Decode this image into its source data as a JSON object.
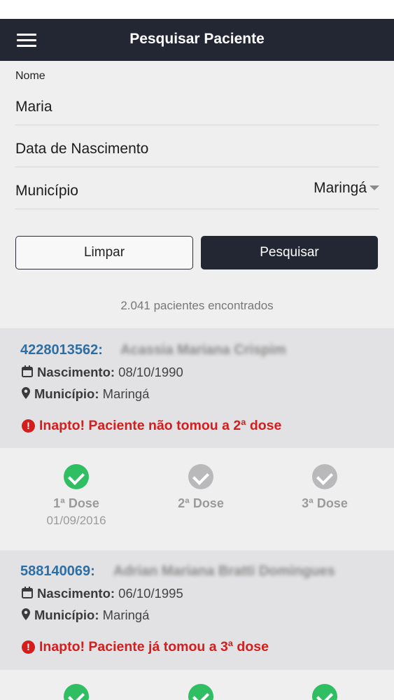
{
  "header": {
    "title": "Pesquisar Paciente",
    "menu_icon": "hamburger-menu-icon"
  },
  "form": {
    "name_label": "Nome",
    "name_value": "Maria",
    "birth_label": "Data de Nascimento",
    "municipality_label": "Município",
    "municipality_value": "Maringá"
  },
  "buttons": {
    "clear": "Limpar",
    "search": "Pesquisar"
  },
  "results": {
    "count_text": "2.041 pacientes encontrados"
  },
  "patients": [
    {
      "id": "4228013562:",
      "name": "Acassia Mariana Crispim",
      "birth_label": "Nascimento:",
      "birth_value": "08/10/1990",
      "municipality_label": "Município:",
      "municipality_value": "Maringá",
      "alert": "Inapto! Paciente não tomou a 2ª dose",
      "doses": [
        {
          "label": "1ª Dose",
          "date": "01/09/2016",
          "status": "done"
        },
        {
          "label": "2ª Dose",
          "date": "",
          "status": "pending"
        },
        {
          "label": "3ª Dose",
          "date": "",
          "status": "pending"
        }
      ]
    },
    {
      "id": "588140069:",
      "name": "Adrian Mariana Bratti Domingues",
      "birth_label": "Nascimento:",
      "birth_value": "06/10/1995",
      "municipality_label": "Município:",
      "municipality_value": "Maringá",
      "alert": "Inapto! Paciente já tomou a 3ª dose",
      "doses": [
        {
          "label": "",
          "date": "",
          "status": "done"
        },
        {
          "label": "",
          "date": "",
          "status": "done"
        },
        {
          "label": "",
          "date": "",
          "status": "done"
        }
      ]
    }
  ],
  "colors": {
    "header_bg": "#232633",
    "id_blue": "#2d6fa5",
    "alert_red": "#d41d1d",
    "check_green": "#2fbf62",
    "check_gray": "#b9b9bb"
  }
}
